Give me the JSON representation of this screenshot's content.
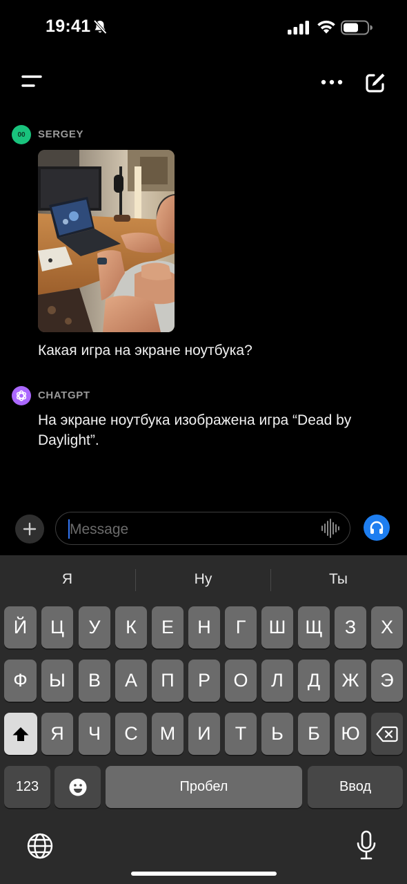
{
  "status_bar": {
    "time": "19:41"
  },
  "icons": {
    "bell_muted": "bell-slash-icon",
    "signal": "cellular-signal-icon",
    "wifi": "wifi-icon",
    "battery": "battery-icon",
    "menu": "menu-icon",
    "more": "more-horizontal-icon",
    "compose": "compose-icon",
    "plus": "plus-icon",
    "waveform": "waveform-icon",
    "headphones": "headphones-icon",
    "shift": "shift-icon",
    "backspace": "backspace-icon",
    "emoji": "emoji-icon",
    "globe": "globe-icon",
    "mic": "microphone-icon"
  },
  "chat": {
    "user": {
      "avatar_initials": "00",
      "name": "SERGEY",
      "message": "Какая игра на экране ноутбука?"
    },
    "assistant": {
      "name": "CHATGPT",
      "message": "На экране ноутбука изображена игра “Dead by Daylight”."
    }
  },
  "composer": {
    "placeholder": "Message"
  },
  "keyboard": {
    "suggestions": [
      "Я",
      "Ну",
      "Ты"
    ],
    "row1": [
      "Й",
      "Ц",
      "У",
      "К",
      "Е",
      "Н",
      "Г",
      "Ш",
      "Щ",
      "З",
      "Х"
    ],
    "row2": [
      "Ф",
      "Ы",
      "В",
      "А",
      "П",
      "Р",
      "О",
      "Л",
      "Д",
      "Ж",
      "Э"
    ],
    "row3": [
      "Я",
      "Ч",
      "С",
      "М",
      "И",
      "Т",
      "Ь",
      "Б",
      "Ю"
    ],
    "numbers_label": "123",
    "space_label": "Пробел",
    "return_label": "Ввод"
  },
  "colors": {
    "background": "#000000",
    "user_avatar": "#19c37d",
    "assistant_avatar": "#ab68ff",
    "voice_button": "#1e7ef0",
    "keyboard_bg": "#2b2b2b",
    "key": "#6b6b6b",
    "key_dark": "#474747"
  }
}
